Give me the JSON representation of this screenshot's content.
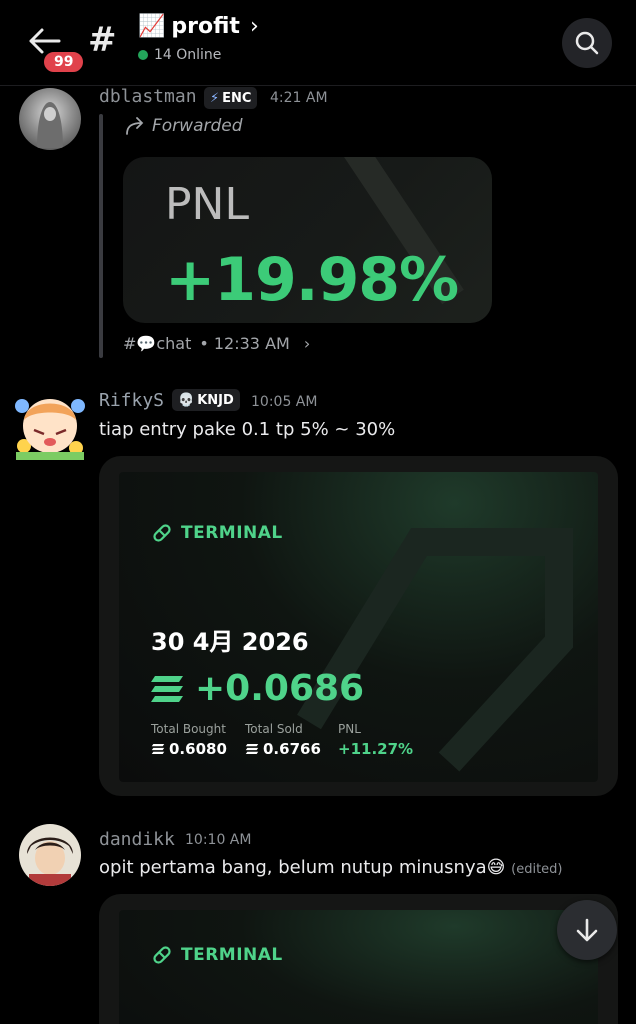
{
  "header": {
    "badge_count": "99",
    "channel_emoji": "📈",
    "channel_name": "profit",
    "online": "14 Online"
  },
  "messages": [
    {
      "username": "dblastman",
      "tag": "ENC",
      "tag_icon": "⚡",
      "time": "4:21 AM",
      "forwarded_label": "Forwarded",
      "card": {
        "label": "PNL",
        "value": "+19.98%"
      },
      "source_channel": "#💬chat",
      "source_time": "• 12:33 AM"
    },
    {
      "username": "RifkyS",
      "tag": "KNJD",
      "tag_icon": "💀",
      "time": "10:05 AM",
      "text": "tiap entry pake 0.1 tp 5% ~ 30%",
      "card": {
        "brand": "TERMINAL",
        "date": "30 4月 2026",
        "amount": "+0.0686",
        "stats": [
          {
            "label": "Total Bought",
            "value": "0.6080"
          },
          {
            "label": "Total Sold",
            "value": "0.6766"
          },
          {
            "label": "PNL",
            "value": "+11.27%"
          }
        ]
      }
    },
    {
      "username": "dandikk",
      "time": "10:10 AM",
      "text": "opit pertama bang, belum nutup minusnya😅",
      "edited": "(edited)",
      "card": {
        "brand": "TERMINAL"
      }
    }
  ],
  "colors": {
    "accent_green": "#3ccb78",
    "badge_red": "#e0424b",
    "online_green": "#23a55a"
  }
}
